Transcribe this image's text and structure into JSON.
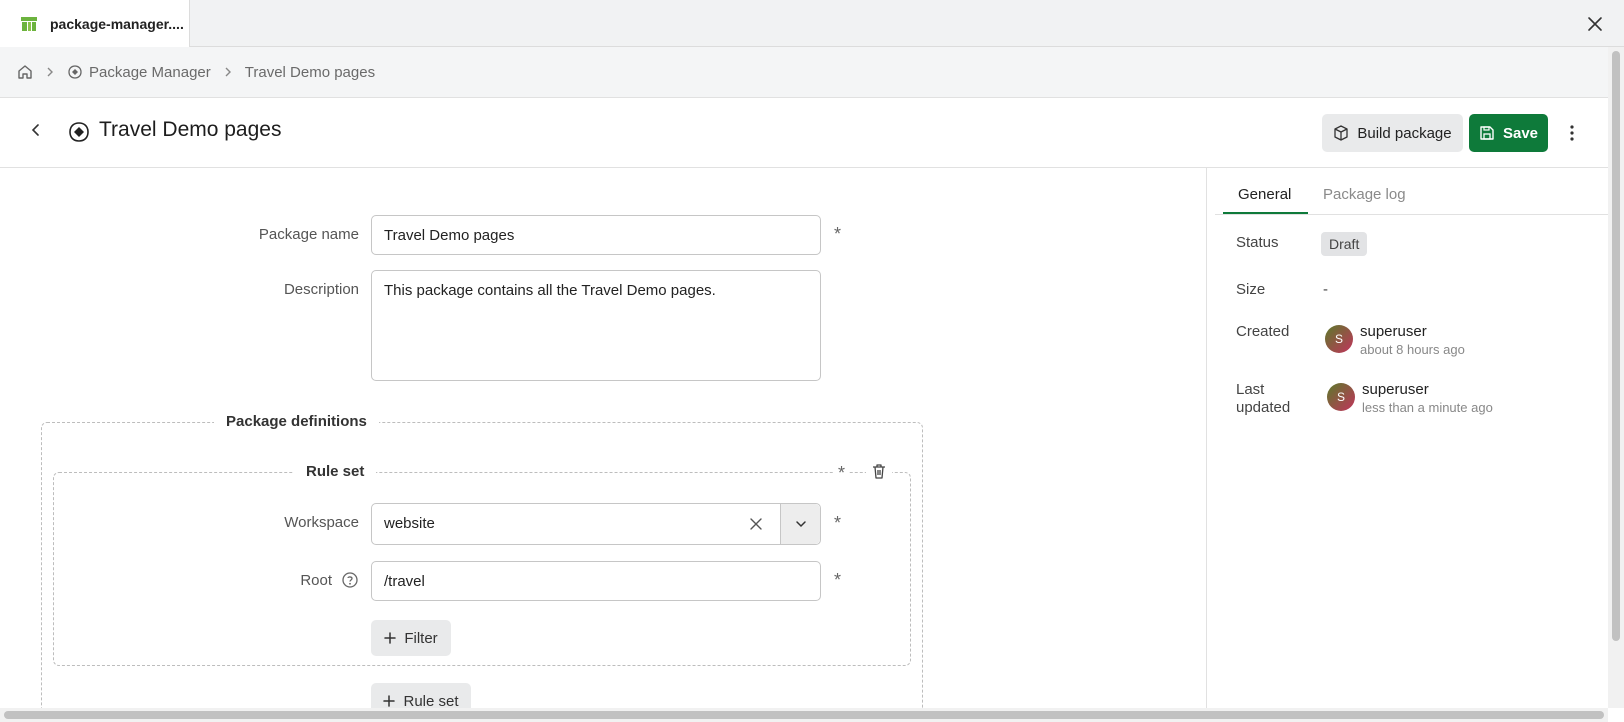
{
  "tab": {
    "title": "package-manager...."
  },
  "breadcrumb": {
    "items": [
      "Package Manager",
      "Travel Demo pages"
    ]
  },
  "header": {
    "title": "Travel Demo pages",
    "build_label": "Build package",
    "save_label": "Save"
  },
  "form": {
    "package_name_label": "Package name",
    "package_name_value": "Travel Demo pages",
    "description_label": "Description",
    "description_value": "This package contains all the Travel Demo pages.",
    "definitions_legend": "Package definitions",
    "ruleset_legend": "Rule set",
    "workspace_label": "Workspace",
    "workspace_value": "website",
    "root_label": "Root",
    "root_value": "/travel",
    "filter_label": "Filter",
    "add_ruleset_label": "Rule set",
    "required_mark": "*"
  },
  "side": {
    "tabs": [
      "General",
      "Package log"
    ],
    "status_label": "Status",
    "status_value": "Draft",
    "size_label": "Size",
    "size_value": "-",
    "created_label": "Created",
    "created_user": "superuser",
    "created_time": "about 8 hours ago",
    "updated_label": "Last updated",
    "updated_user": "superuser",
    "updated_time": "less than a minute ago",
    "avatar_initial": "S"
  },
  "colors": {
    "accent": "#0e7a3a",
    "badge_bg": "#e2e3e5"
  }
}
